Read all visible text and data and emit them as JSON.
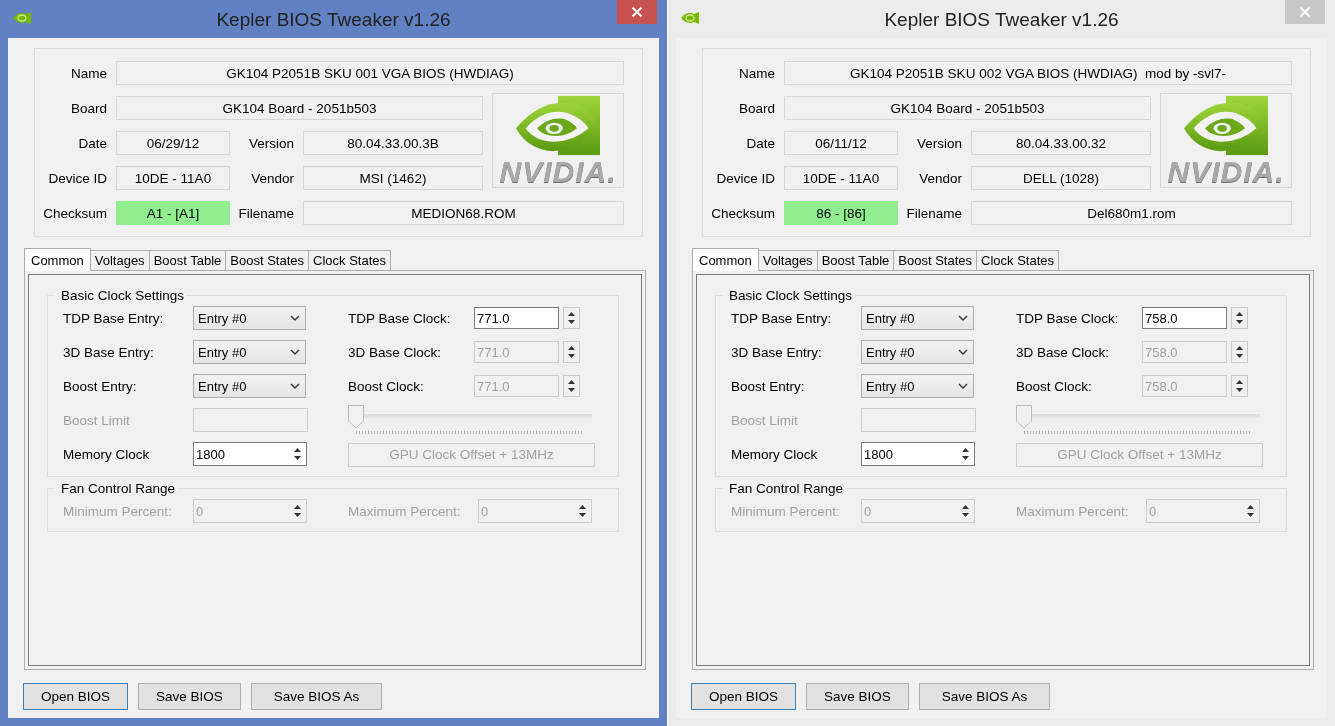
{
  "windows": [
    {
      "title": "Kepler BIOS Tweaker v1.26",
      "active": true,
      "logo_text": "NVIDIA.",
      "info": [
        {
          "kind": "name",
          "label": "Name",
          "value": "GK104 P2051B SKU 001 VGA BIOS (HWDIAG)"
        },
        {
          "kind": "board",
          "label": "Board",
          "value": "GK104 Board - 2051b503"
        },
        {
          "kind": "date",
          "label": "Date",
          "value": "06/29/12"
        },
        {
          "kind": "version",
          "label": "Version",
          "value": "80.04.33.00.3B"
        },
        {
          "kind": "device",
          "label": "Device ID",
          "value": "10DE - 11A0"
        },
        {
          "kind": "vendor",
          "label": "Vendor",
          "value": "MSI (1462)"
        },
        {
          "kind": "checksum",
          "label": "Checksum",
          "value": "A1 - [A1]",
          "valid": true
        },
        {
          "kind": "filename",
          "label": "Filename",
          "value": "MEDION68.ROM"
        }
      ],
      "tabs": [
        {
          "label": "Common",
          "selected": true
        },
        {
          "label": "Voltages",
          "selected": false
        },
        {
          "label": "Boost Table",
          "selected": false
        },
        {
          "label": "Boost States",
          "selected": false
        },
        {
          "label": "Clock States",
          "selected": false
        }
      ],
      "groups": [
        {
          "title": "Basic Clock Settings",
          "columns": [
            [
              {
                "kind": "dropdown",
                "label": "TDP Base Entry:",
                "value": "Entry #0",
                "disabled": false
              },
              {
                "kind": "dropdown",
                "label": "3D Base Entry:",
                "value": "Entry #0",
                "disabled": false
              },
              {
                "kind": "dropdown",
                "label": "Boost Entry:",
                "value": "Entry #0",
                "disabled": false
              },
              {
                "kind": "textbox",
                "label": "Boost Limit",
                "disabled": true
              },
              {
                "kind": "updown",
                "label": "Memory Clock",
                "value": "1800",
                "disabled": false
              }
            ],
            [
              {
                "kind": "spinner",
                "label": "TDP Base Clock:",
                "value": "771.0",
                "disabled": false
              },
              {
                "kind": "spinner",
                "label": "3D Base Clock:",
                "value": "771.0",
                "disabled": true
              },
              {
                "kind": "spinner",
                "label": "Boost Clock:",
                "value": "771.0",
                "disabled": true
              },
              {
                "kind": "slider",
                "level": 0,
                "disabled": true
              },
              {
                "kind": "button",
                "label": "GPU Clock Offset + 13MHz",
                "disabled": true
              }
            ]
          ]
        },
        {
          "title": "Fan Control Range",
          "columns": [
            [
              {
                "kind": "updown",
                "label": "Minimum Percent:",
                "value": "0",
                "disabled": true
              }
            ],
            [
              {
                "kind": "updown",
                "label": "Maximum Percent:",
                "value": "0",
                "disabled": true
              }
            ]
          ]
        }
      ],
      "buttons": [
        {
          "label": "Open BIOS",
          "default": true
        },
        {
          "label": "Save BIOS",
          "default": false
        },
        {
          "label": "Save BIOS As",
          "default": false
        }
      ]
    },
    {
      "title": "Kepler BIOS Tweaker v1.26",
      "active": false,
      "logo_text": "NVIDIA.",
      "info": [
        {
          "kind": "name",
          "label": "Name",
          "value": "GK104 P2051B SKU 002 VGA BIOS (HWDIAG)  mod by -svl7-"
        },
        {
          "kind": "board",
          "label": "Board",
          "value": "GK104 Board - 2051b503"
        },
        {
          "kind": "date",
          "label": "Date",
          "value": "06/11/12"
        },
        {
          "kind": "version",
          "label": "Version",
          "value": "80.04.33.00.32"
        },
        {
          "kind": "device",
          "label": "Device ID",
          "value": "10DE - 11A0"
        },
        {
          "kind": "vendor",
          "label": "Vendor",
          "value": "DELL (1028)"
        },
        {
          "kind": "checksum",
          "label": "Checksum",
          "value": "86 - [86]",
          "valid": true
        },
        {
          "kind": "filename",
          "label": "Filename",
          "value": "Del680m1.rom"
        }
      ],
      "tabs": [
        {
          "label": "Common",
          "selected": true
        },
        {
          "label": "Voltages",
          "selected": false
        },
        {
          "label": "Boost Table",
          "selected": false
        },
        {
          "label": "Boost States",
          "selected": false
        },
        {
          "label": "Clock States",
          "selected": false
        }
      ],
      "groups": [
        {
          "title": "Basic Clock Settings",
          "columns": [
            [
              {
                "kind": "dropdown",
                "label": "TDP Base Entry:",
                "value": "Entry #0",
                "disabled": false
              },
              {
                "kind": "dropdown",
                "label": "3D Base Entry:",
                "value": "Entry #0",
                "disabled": false
              },
              {
                "kind": "dropdown",
                "label": "Boost Entry:",
                "value": "Entry #0",
                "disabled": false
              },
              {
                "kind": "textbox",
                "label": "Boost Limit",
                "disabled": true
              },
              {
                "kind": "updown",
                "label": "Memory Clock",
                "value": "1800",
                "disabled": false
              }
            ],
            [
              {
                "kind": "spinner",
                "label": "TDP Base Clock:",
                "value": "758.0",
                "disabled": false
              },
              {
                "kind": "spinner",
                "label": "3D Base Clock:",
                "value": "758.0",
                "disabled": true
              },
              {
                "kind": "spinner",
                "label": "Boost Clock:",
                "value": "758.0",
                "disabled": true
              },
              {
                "kind": "slider",
                "level": 0,
                "disabled": true
              },
              {
                "kind": "button",
                "label": "GPU Clock Offset + 13MHz",
                "disabled": true
              }
            ]
          ]
        },
        {
          "title": "Fan Control Range",
          "columns": [
            [
              {
                "kind": "updown",
                "label": "Minimum Percent:",
                "value": "0",
                "disabled": true
              }
            ],
            [
              {
                "kind": "updown",
                "label": "Maximum Percent:",
                "value": "0",
                "disabled": true
              }
            ]
          ]
        }
      ],
      "buttons": [
        {
          "label": "Open BIOS",
          "default": true
        },
        {
          "label": "Save BIOS",
          "default": false
        },
        {
          "label": "Save BIOS As",
          "default": false
        }
      ]
    }
  ]
}
